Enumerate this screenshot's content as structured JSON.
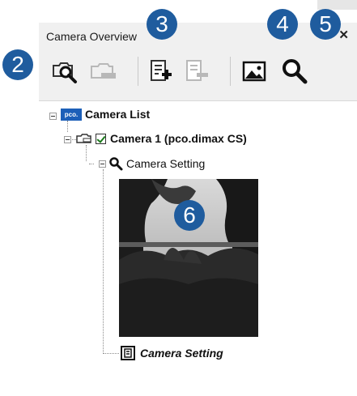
{
  "panel": {
    "title": "Camera Overview",
    "close_label": "✕"
  },
  "toolbar": {
    "buttons": [
      {
        "name": "search-camera"
      },
      {
        "name": "camera-disabled"
      },
      {
        "name": "add-setting"
      },
      {
        "name": "remove-setting"
      },
      {
        "name": "show-image"
      },
      {
        "name": "zoom-image"
      }
    ]
  },
  "tree": {
    "root_label": "Camera List",
    "root_logo": "pco.",
    "camera_label": "Camera 1 (pco.dimax CS)",
    "camera_checked": true,
    "setting_label": "Camera Setting",
    "setting_detail_label": "Camera Setting"
  },
  "callouts": [
    "2",
    "3",
    "4",
    "5",
    "6"
  ],
  "colors": {
    "callout": "#1f5c9e",
    "pco_logo": "#1c5fb8",
    "panel_bg": "#f0f0f0"
  }
}
